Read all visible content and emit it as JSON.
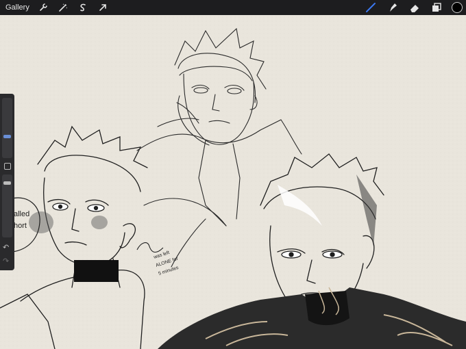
{
  "toolbar": {
    "gallery_label": "Gallery",
    "left_tools": [
      "wrench-icon",
      "magic-wand-icon",
      "selection-icon",
      "transform-arrow-icon"
    ],
    "right_tools": [
      "brush-icon",
      "smudge-icon",
      "eraser-icon",
      "layers-icon"
    ],
    "active_color": "#000000",
    "active_tool_color": "#3b78f0"
  },
  "sidebar": {
    "brush_size_level": 0.2,
    "opacity_level": 0.12
  },
  "canvas": {
    "background": "#e9e5dc",
    "speech_bubble_lines": [
      "alled",
      "hort"
    ],
    "note_lines": [
      "was left",
      "ALONE for",
      "5 minutes"
    ]
  }
}
